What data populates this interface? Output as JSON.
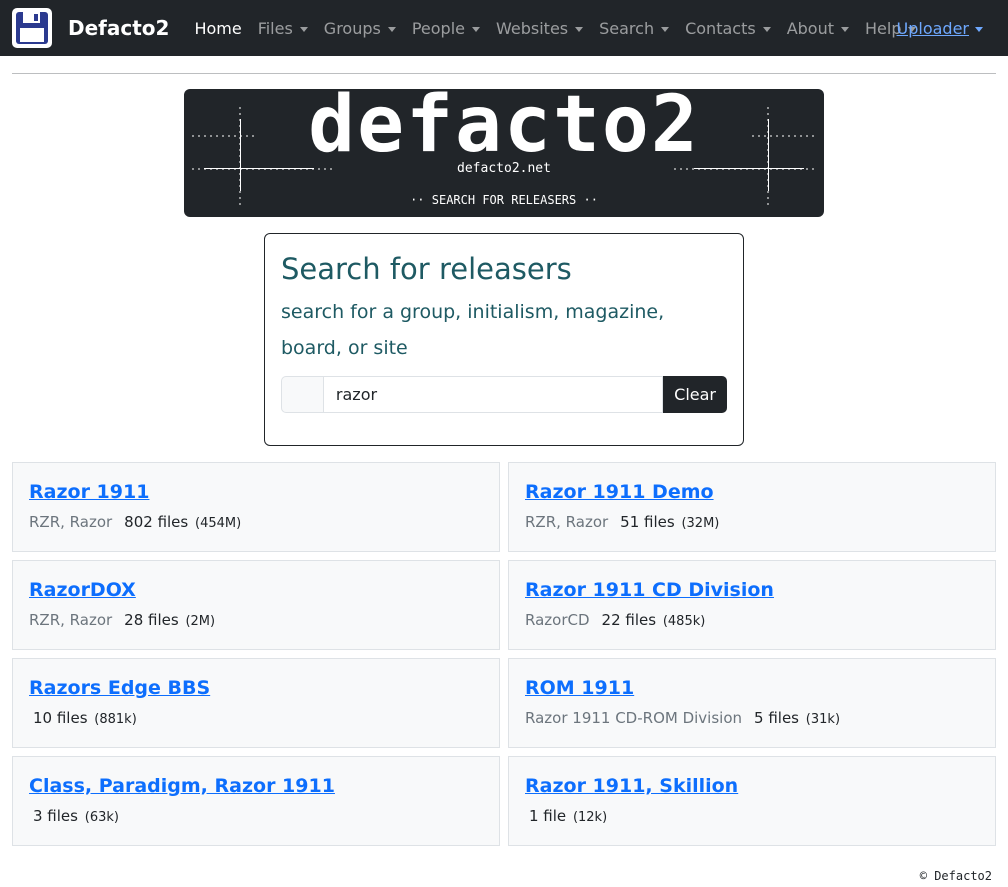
{
  "navbar": {
    "brand": "Defacto2",
    "items": [
      {
        "label": "Home",
        "active": true,
        "dropdown": false
      },
      {
        "label": "Files",
        "dropdown": true
      },
      {
        "label": "Groups",
        "dropdown": true
      },
      {
        "label": "People",
        "dropdown": true
      },
      {
        "label": "Websites",
        "dropdown": true
      },
      {
        "label": "Search",
        "dropdown": true
      },
      {
        "label": "Contacts",
        "dropdown": true
      },
      {
        "label": "About",
        "dropdown": true
      },
      {
        "label": "Help",
        "dropdown": true
      }
    ],
    "uploader": "Uploader"
  },
  "banner": {
    "logo_text": "defacto2",
    "site": "defacto2.net",
    "subtitle": "SEARCH FOR RELEASERS"
  },
  "search": {
    "title": "Search for releasers",
    "lead": "search for a group, initialism, magazine, board, or site",
    "value": "razor",
    "clear_label": "Clear"
  },
  "results": [
    {
      "name": "Razor 1911",
      "aliases": "RZR, Razor",
      "files": "802 files",
      "size": "(454M)"
    },
    {
      "name": "Razor 1911 Demo",
      "aliases": "RZR, Razor",
      "files": "51 files",
      "size": "(32M)"
    },
    {
      "name": "RazorDOX",
      "aliases": "RZR, Razor",
      "files": "28 files",
      "size": "(2M)"
    },
    {
      "name": "Razor 1911 CD Division",
      "aliases": "RazorCD",
      "files": "22 files",
      "size": "(485k)"
    },
    {
      "name": "Razors Edge BBS",
      "aliases": "",
      "files": "10 files",
      "size": "(881k)"
    },
    {
      "name": "ROM 1911",
      "aliases": "Razor 1911 CD-ROM Division",
      "files": "5 files",
      "size": "(31k)"
    },
    {
      "name": "Class, Paradigm, Razor 1911",
      "aliases": "",
      "files": "3 files",
      "size": "(63k)"
    },
    {
      "name": "Razor 1911, Skillion",
      "aliases": "",
      "files": "1 file",
      "size": "(12k)"
    }
  ],
  "footer": "© Defacto2",
  "colors": {
    "navbar_bg": "#212529",
    "link": "#0d6efd",
    "heading": "#1e5a63",
    "card_bg": "#f8f9fa"
  },
  "icons": {
    "logo": "floppy-disk-icon",
    "dropdown": "caret-down-icon"
  }
}
